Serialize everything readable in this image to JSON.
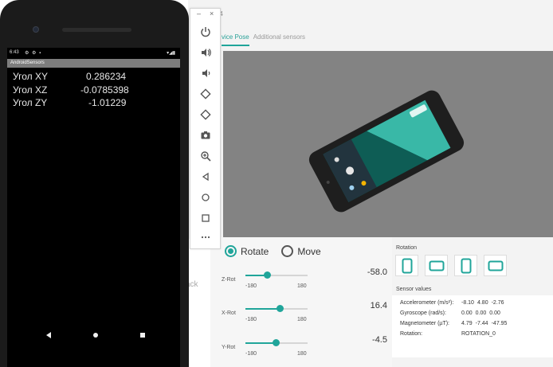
{
  "window": {
    "title_fragment": "5554"
  },
  "tabs": [
    {
      "label": "vice Pose"
    },
    {
      "label": "Additional sensors"
    }
  ],
  "toolbar": {
    "minimize": "–",
    "close": "×"
  },
  "mode": {
    "rotate": "Rotate",
    "move": "Move",
    "selected": "Rotate"
  },
  "sliders": [
    {
      "name": "Z-Rot",
      "min": "-180",
      "max": "180",
      "value": "-58.0",
      "fraction": 0.34
    },
    {
      "name": "X-Rot",
      "min": "-180",
      "max": "180",
      "value": "16.4",
      "fraction": 0.55
    },
    {
      "name": "Y-Rot",
      "min": "-180",
      "max": "180",
      "value": "-4.5",
      "fraction": 0.49
    }
  ],
  "rotation": {
    "label": "Rotation"
  },
  "sensors": {
    "label": "Sensor values",
    "rows": [
      {
        "name": "Accelerometer (m/s²):",
        "values": [
          "-8.10",
          "4.80",
          "-2.76"
        ]
      },
      {
        "name": "Gyroscope (rad/s):",
        "values": [
          "0.00",
          "0.00",
          "0.00"
        ]
      },
      {
        "name": "Magnetometer (µT):",
        "values": [
          "4.79",
          "-7.44",
          "-47.95"
        ]
      },
      {
        "name": "Rotation:",
        "values": [
          "ROTATION_0"
        ]
      }
    ]
  },
  "ghost_text": "ack",
  "phone": {
    "status_time": "6:43",
    "status_icons": "⚙ ⚙ ▪",
    "status_right": "▾◢▮",
    "app_title": "AndroidSensors",
    "readings": [
      {
        "label": "Угол XY",
        "value": "0.286234"
      },
      {
        "label": "Угол XZ",
        "value": "-0.0785398"
      },
      {
        "label": "Угол ZY",
        "value": "-1.01229"
      }
    ]
  },
  "colors": {
    "accent": "#20a59a",
    "viewport": "#838383",
    "phone_body": "#1b1b1b"
  }
}
